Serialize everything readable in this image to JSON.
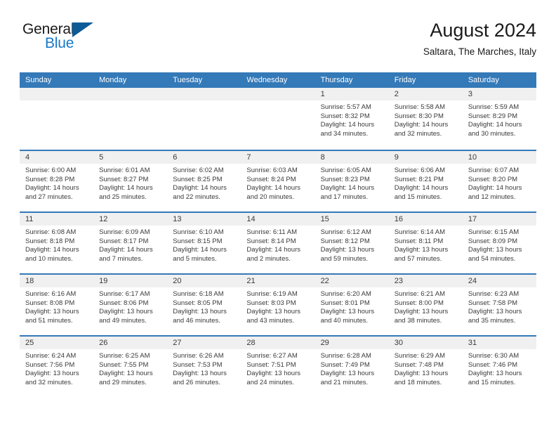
{
  "brand": {
    "word_one": "General",
    "word_two": "Blue",
    "flag_icon": "triangle-flag-icon",
    "primary_color": "#1878c8",
    "flag_color": "#0d5b96"
  },
  "header": {
    "title": "August 2024",
    "subtitle": "Saltara, The Marches, Italy"
  },
  "calendar": {
    "header_color": "#3479b8",
    "day_band_color": "#f0f0f0",
    "weekday_labels": [
      "Sunday",
      "Monday",
      "Tuesday",
      "Wednesday",
      "Thursday",
      "Friday",
      "Saturday"
    ],
    "weeks": [
      [
        {
          "date": "",
          "empty": true,
          "sunrise": "",
          "sunset": "",
          "daylight_line1": "",
          "daylight_line2": ""
        },
        {
          "date": "",
          "empty": true,
          "sunrise": "",
          "sunset": "",
          "daylight_line1": "",
          "daylight_line2": ""
        },
        {
          "date": "",
          "empty": true,
          "sunrise": "",
          "sunset": "",
          "daylight_line1": "",
          "daylight_line2": ""
        },
        {
          "date": "",
          "empty": true,
          "sunrise": "",
          "sunset": "",
          "daylight_line1": "",
          "daylight_line2": ""
        },
        {
          "date": "1",
          "empty": false,
          "sunrise": "Sunrise: 5:57 AM",
          "sunset": "Sunset: 8:32 PM",
          "daylight_line1": "Daylight: 14 hours",
          "daylight_line2": "and 34 minutes."
        },
        {
          "date": "2",
          "empty": false,
          "sunrise": "Sunrise: 5:58 AM",
          "sunset": "Sunset: 8:30 PM",
          "daylight_line1": "Daylight: 14 hours",
          "daylight_line2": "and 32 minutes."
        },
        {
          "date": "3",
          "empty": false,
          "sunrise": "Sunrise: 5:59 AM",
          "sunset": "Sunset: 8:29 PM",
          "daylight_line1": "Daylight: 14 hours",
          "daylight_line2": "and 30 minutes."
        }
      ],
      [
        {
          "date": "4",
          "empty": false,
          "sunrise": "Sunrise: 6:00 AM",
          "sunset": "Sunset: 8:28 PM",
          "daylight_line1": "Daylight: 14 hours",
          "daylight_line2": "and 27 minutes."
        },
        {
          "date": "5",
          "empty": false,
          "sunrise": "Sunrise: 6:01 AM",
          "sunset": "Sunset: 8:27 PM",
          "daylight_line1": "Daylight: 14 hours",
          "daylight_line2": "and 25 minutes."
        },
        {
          "date": "6",
          "empty": false,
          "sunrise": "Sunrise: 6:02 AM",
          "sunset": "Sunset: 8:25 PM",
          "daylight_line1": "Daylight: 14 hours",
          "daylight_line2": "and 22 minutes."
        },
        {
          "date": "7",
          "empty": false,
          "sunrise": "Sunrise: 6:03 AM",
          "sunset": "Sunset: 8:24 PM",
          "daylight_line1": "Daylight: 14 hours",
          "daylight_line2": "and 20 minutes."
        },
        {
          "date": "8",
          "empty": false,
          "sunrise": "Sunrise: 6:05 AM",
          "sunset": "Sunset: 8:23 PM",
          "daylight_line1": "Daylight: 14 hours",
          "daylight_line2": "and 17 minutes."
        },
        {
          "date": "9",
          "empty": false,
          "sunrise": "Sunrise: 6:06 AM",
          "sunset": "Sunset: 8:21 PM",
          "daylight_line1": "Daylight: 14 hours",
          "daylight_line2": "and 15 minutes."
        },
        {
          "date": "10",
          "empty": false,
          "sunrise": "Sunrise: 6:07 AM",
          "sunset": "Sunset: 8:20 PM",
          "daylight_line1": "Daylight: 14 hours",
          "daylight_line2": "and 12 minutes."
        }
      ],
      [
        {
          "date": "11",
          "empty": false,
          "sunrise": "Sunrise: 6:08 AM",
          "sunset": "Sunset: 8:18 PM",
          "daylight_line1": "Daylight: 14 hours",
          "daylight_line2": "and 10 minutes."
        },
        {
          "date": "12",
          "empty": false,
          "sunrise": "Sunrise: 6:09 AM",
          "sunset": "Sunset: 8:17 PM",
          "daylight_line1": "Daylight: 14 hours",
          "daylight_line2": "and 7 minutes."
        },
        {
          "date": "13",
          "empty": false,
          "sunrise": "Sunrise: 6:10 AM",
          "sunset": "Sunset: 8:15 PM",
          "daylight_line1": "Daylight: 14 hours",
          "daylight_line2": "and 5 minutes."
        },
        {
          "date": "14",
          "empty": false,
          "sunrise": "Sunrise: 6:11 AM",
          "sunset": "Sunset: 8:14 PM",
          "daylight_line1": "Daylight: 14 hours",
          "daylight_line2": "and 2 minutes."
        },
        {
          "date": "15",
          "empty": false,
          "sunrise": "Sunrise: 6:12 AM",
          "sunset": "Sunset: 8:12 PM",
          "daylight_line1": "Daylight: 13 hours",
          "daylight_line2": "and 59 minutes."
        },
        {
          "date": "16",
          "empty": false,
          "sunrise": "Sunrise: 6:14 AM",
          "sunset": "Sunset: 8:11 PM",
          "daylight_line1": "Daylight: 13 hours",
          "daylight_line2": "and 57 minutes."
        },
        {
          "date": "17",
          "empty": false,
          "sunrise": "Sunrise: 6:15 AM",
          "sunset": "Sunset: 8:09 PM",
          "daylight_line1": "Daylight: 13 hours",
          "daylight_line2": "and 54 minutes."
        }
      ],
      [
        {
          "date": "18",
          "empty": false,
          "sunrise": "Sunrise: 6:16 AM",
          "sunset": "Sunset: 8:08 PM",
          "daylight_line1": "Daylight: 13 hours",
          "daylight_line2": "and 51 minutes."
        },
        {
          "date": "19",
          "empty": false,
          "sunrise": "Sunrise: 6:17 AM",
          "sunset": "Sunset: 8:06 PM",
          "daylight_line1": "Daylight: 13 hours",
          "daylight_line2": "and 49 minutes."
        },
        {
          "date": "20",
          "empty": false,
          "sunrise": "Sunrise: 6:18 AM",
          "sunset": "Sunset: 8:05 PM",
          "daylight_line1": "Daylight: 13 hours",
          "daylight_line2": "and 46 minutes."
        },
        {
          "date": "21",
          "empty": false,
          "sunrise": "Sunrise: 6:19 AM",
          "sunset": "Sunset: 8:03 PM",
          "daylight_line1": "Daylight: 13 hours",
          "daylight_line2": "and 43 minutes."
        },
        {
          "date": "22",
          "empty": false,
          "sunrise": "Sunrise: 6:20 AM",
          "sunset": "Sunset: 8:01 PM",
          "daylight_line1": "Daylight: 13 hours",
          "daylight_line2": "and 40 minutes."
        },
        {
          "date": "23",
          "empty": false,
          "sunrise": "Sunrise: 6:21 AM",
          "sunset": "Sunset: 8:00 PM",
          "daylight_line1": "Daylight: 13 hours",
          "daylight_line2": "and 38 minutes."
        },
        {
          "date": "24",
          "empty": false,
          "sunrise": "Sunrise: 6:23 AM",
          "sunset": "Sunset: 7:58 PM",
          "daylight_line1": "Daylight: 13 hours",
          "daylight_line2": "and 35 minutes."
        }
      ],
      [
        {
          "date": "25",
          "empty": false,
          "sunrise": "Sunrise: 6:24 AM",
          "sunset": "Sunset: 7:56 PM",
          "daylight_line1": "Daylight: 13 hours",
          "daylight_line2": "and 32 minutes."
        },
        {
          "date": "26",
          "empty": false,
          "sunrise": "Sunrise: 6:25 AM",
          "sunset": "Sunset: 7:55 PM",
          "daylight_line1": "Daylight: 13 hours",
          "daylight_line2": "and 29 minutes."
        },
        {
          "date": "27",
          "empty": false,
          "sunrise": "Sunrise: 6:26 AM",
          "sunset": "Sunset: 7:53 PM",
          "daylight_line1": "Daylight: 13 hours",
          "daylight_line2": "and 26 minutes."
        },
        {
          "date": "28",
          "empty": false,
          "sunrise": "Sunrise: 6:27 AM",
          "sunset": "Sunset: 7:51 PM",
          "daylight_line1": "Daylight: 13 hours",
          "daylight_line2": "and 24 minutes."
        },
        {
          "date": "29",
          "empty": false,
          "sunrise": "Sunrise: 6:28 AM",
          "sunset": "Sunset: 7:49 PM",
          "daylight_line1": "Daylight: 13 hours",
          "daylight_line2": "and 21 minutes."
        },
        {
          "date": "30",
          "empty": false,
          "sunrise": "Sunrise: 6:29 AM",
          "sunset": "Sunset: 7:48 PM",
          "daylight_line1": "Daylight: 13 hours",
          "daylight_line2": "and 18 minutes."
        },
        {
          "date": "31",
          "empty": false,
          "sunrise": "Sunrise: 6:30 AM",
          "sunset": "Sunset: 7:46 PM",
          "daylight_line1": "Daylight: 13 hours",
          "daylight_line2": "and 15 minutes."
        }
      ]
    ]
  }
}
